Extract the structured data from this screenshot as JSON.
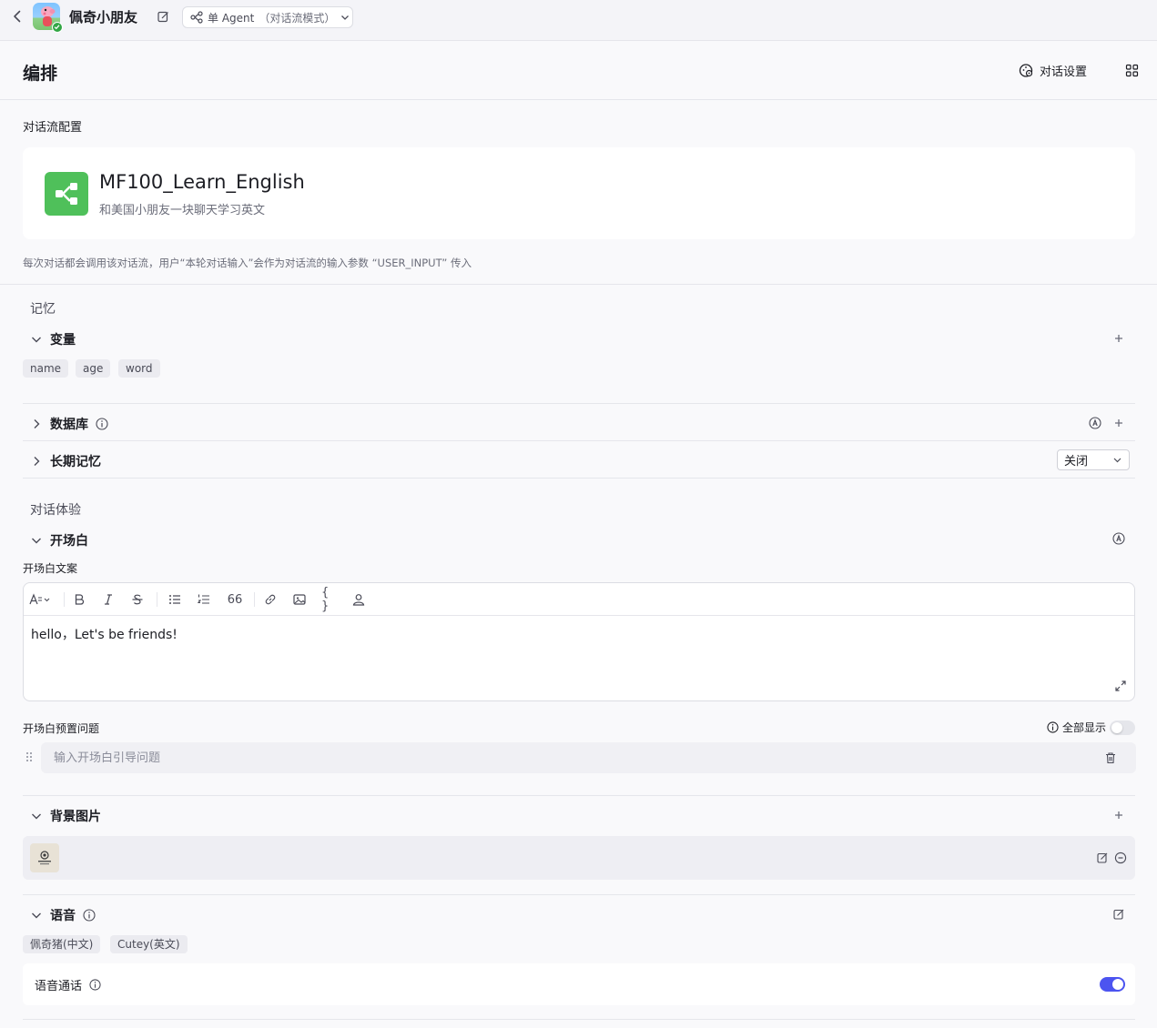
{
  "topbar": {
    "bot_name": "佩奇小朋友",
    "mode_label": "单 Agent",
    "mode_suffix": "（对话流模式）"
  },
  "header": {
    "title": "编排",
    "settings_label": "对话设置"
  },
  "flow": {
    "section_label": "对话流配置",
    "name": "MF100_Learn_English",
    "description": "和美国小朋友一块聊天学习英文",
    "hint": "每次对话都会调用该对话流，用户“本轮对话输入”会作为对话流的输入参数 “USER_INPUT” 传入"
  },
  "memory": {
    "group_label": "记忆",
    "variables": {
      "title": "变量",
      "chips": [
        "name",
        "age",
        "word"
      ]
    },
    "database": {
      "title": "数据库"
    },
    "long_term": {
      "title": "长期记忆",
      "select_value": "关闭"
    }
  },
  "experience": {
    "group_label": "对话体验",
    "opening": {
      "title": "开场白",
      "copy_label": "开场白文案",
      "toolbar_quote": "66",
      "toolbar_code": "{ }",
      "text": "hello，Let's be friends!",
      "preset_label": "开场白预置问题",
      "show_all_label": "全部显示",
      "question_placeholder": "输入开场白引导问题"
    },
    "background": {
      "title": "背景图片"
    },
    "voice": {
      "title": "语音",
      "chips": [
        "佩奇猪(中文)",
        "Cutey(英文)"
      ],
      "call_label": "语音通话",
      "call_enabled": true
    }
  },
  "colors": {
    "accent": "#4c54f0",
    "flow_icon": "#4fc05a",
    "verified": "#32a645"
  }
}
